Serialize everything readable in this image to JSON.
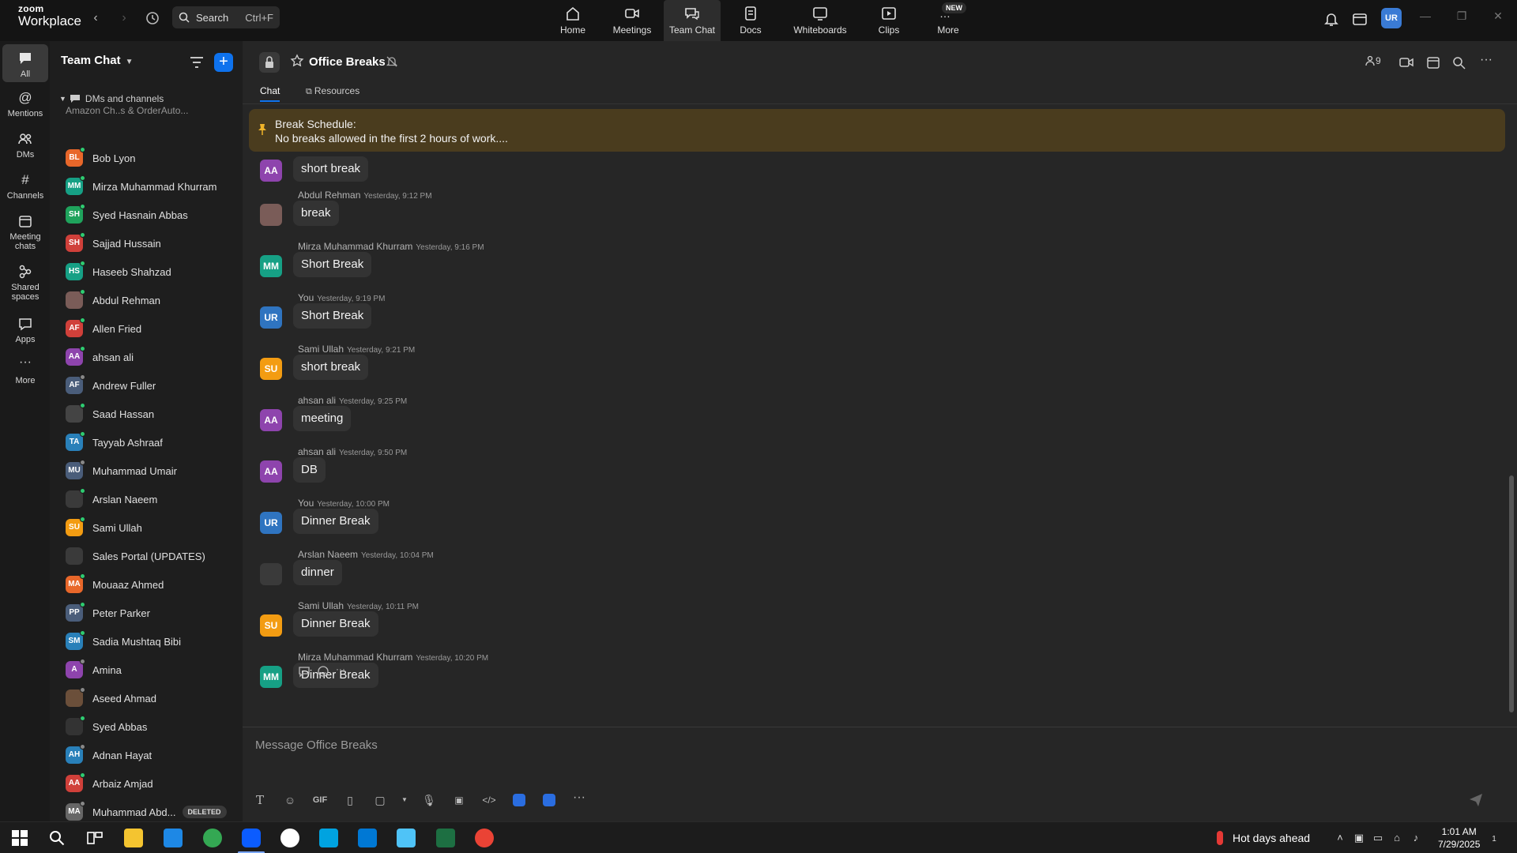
{
  "app": {
    "brand_small": "zoom",
    "brand_big": "Workplace"
  },
  "top_search": {
    "label": "Search",
    "shortcut": "Ctrl+F"
  },
  "top_tabs": [
    {
      "label": "Home"
    },
    {
      "label": "Meetings"
    },
    {
      "label": "Team Chat"
    },
    {
      "label": "Docs"
    },
    {
      "label": "Whiteboards"
    },
    {
      "label": "Clips"
    },
    {
      "label": "More"
    }
  ],
  "new_badge": "NEW",
  "user_initials": "UR",
  "rail": [
    {
      "label": "All"
    },
    {
      "label": "Mentions"
    },
    {
      "label": "DMs"
    },
    {
      "label": "Channels"
    },
    {
      "label": "Meeting chats"
    },
    {
      "label": "Shared spaces"
    },
    {
      "label": "Apps"
    },
    {
      "label": "More"
    }
  ],
  "channel_list": {
    "header": "Team Chat",
    "section": "DMs and channels",
    "partial_top": "Amazon Ch..s & OrderAuto...",
    "items": [
      {
        "initials": "BL",
        "name": "Bob Lyon",
        "color": "#e8672a",
        "status": "#2ecc71"
      },
      {
        "initials": "MM",
        "name": "Mirza Muhammad Khurram",
        "color": "#16a085",
        "status": "#2ecc71"
      },
      {
        "initials": "SH",
        "name": "Syed Hasnain Abbas",
        "color": "#1fa35c",
        "status": "#2ecc71"
      },
      {
        "initials": "SH",
        "name": "Sajjad Hussain",
        "color": "#d0403a",
        "status": "#2ecc71"
      },
      {
        "initials": "HS",
        "name": "Haseeb Shahzad",
        "color": "#16a085",
        "status": "#2ecc71"
      },
      {
        "initials": "",
        "name": "Abdul Rehman",
        "color": "#7a5c58",
        "status": "#2ecc71"
      },
      {
        "initials": "AF",
        "name": "Allen Fried",
        "color": "#d0403a",
        "status": "#2ecc71"
      },
      {
        "initials": "AA",
        "name": "ahsan ali",
        "color": "#8e44ad",
        "status": "#2ecc71"
      },
      {
        "initials": "AF",
        "name": "Andrew Fuller",
        "color": "#4a5d7a",
        "status": "#888888"
      },
      {
        "initials": "",
        "name": "Saad Hassan",
        "color": "#444444",
        "status": "#2ecc71"
      },
      {
        "initials": "TA",
        "name": "Tayyab Ashraaf",
        "color": "#2980b9",
        "status": "#2ecc71"
      },
      {
        "initials": "MU",
        "name": "Muhammad Umair",
        "color": "#4a5d7a",
        "status": "#888888"
      },
      {
        "initials": "",
        "name": "Arslan Naeem",
        "color": "#3a3a3a",
        "status": "#2ecc71"
      },
      {
        "initials": "SU",
        "name": "Sami Ullah",
        "color": "#f39c12",
        "status": "#2ecc71"
      },
      {
        "initials": "",
        "name": "Sales Portal (UPDATES)",
        "color": "#3a3a3a",
        "status": ""
      },
      {
        "initials": "MA",
        "name": "Mouaaz Ahmed",
        "color": "#e8672a",
        "status": "#2ecc71"
      },
      {
        "initials": "PP",
        "name": "Peter Parker",
        "color": "#4a5d7a",
        "status": "#2ecc71"
      },
      {
        "initials": "SM",
        "name": "Sadia Mushtaq Bibi",
        "color": "#2980b9",
        "status": "#2ecc71"
      },
      {
        "initials": "A",
        "name": "Amina",
        "color": "#8e44ad",
        "status": "#888888"
      },
      {
        "initials": "",
        "name": "Aseed Ahmad",
        "color": "#6b4f3a",
        "status": "#888888"
      },
      {
        "initials": "",
        "name": "Syed Abbas",
        "color": "#333333",
        "status": "#2ecc71"
      },
      {
        "initials": "AH",
        "name": "Adnan Hayat",
        "color": "#2980b9",
        "status": "#888888"
      },
      {
        "initials": "AA",
        "name": "Arbaiz Amjad",
        "color": "#d0403a",
        "status": "#2ecc71"
      },
      {
        "initials": "MA",
        "name": "Muhammad Abd...",
        "color": "#666666",
        "status": "#888888",
        "tag": "DELETED"
      }
    ]
  },
  "channel": {
    "title": "Office Breaks",
    "tabs": [
      "Chat",
      "Resources"
    ],
    "member_count": "9",
    "pinned_title": "Break Schedule:",
    "pinned_text": "No breaks allowed in the first 2 hours of work...."
  },
  "messages": [
    {
      "sender": "",
      "time": "",
      "text": "short break",
      "initials": "AA",
      "color": "#8e44ad"
    },
    {
      "sender": "Abdul Rehman",
      "time": "Yesterday, 9:12 PM",
      "text": "break",
      "initials": "",
      "color": "#7a5c58"
    },
    {
      "sender": "Mirza Muhammad Khurram",
      "time": "Yesterday, 9:16 PM",
      "text": "Short Break",
      "initials": "MM",
      "color": "#16a085"
    },
    {
      "sender": "You",
      "time": "Yesterday, 9:19 PM",
      "text": "Short Break",
      "initials": "UR",
      "color": "#2f74c0"
    },
    {
      "sender": "Sami Ullah",
      "time": "Yesterday, 9:21 PM",
      "text": "short break",
      "initials": "SU",
      "color": "#f39c12"
    },
    {
      "sender": "ahsan ali",
      "time": "Yesterday, 9:25 PM",
      "text": "meeting",
      "initials": "AA",
      "color": "#8e44ad"
    },
    {
      "sender": "ahsan ali",
      "time": "Yesterday, 9:50 PM",
      "text": "DB",
      "initials": "AA",
      "color": "#8e44ad"
    },
    {
      "sender": "You",
      "time": "Yesterday, 10:00 PM",
      "text": "Dinner Break",
      "initials": "UR",
      "color": "#2f74c0"
    },
    {
      "sender": "Arslan Naeem",
      "time": "Yesterday, 10:04 PM",
      "text": "dinner",
      "initials": "",
      "color": "#3a3a3a"
    },
    {
      "sender": "Sami Ullah",
      "time": "Yesterday, 10:11 PM",
      "text": "Dinner Break",
      "initials": "SU",
      "color": "#f39c12"
    },
    {
      "sender": "Mirza Muhammad Khurram",
      "time": "Yesterday, 10:20 PM",
      "text": "Dinner Break",
      "initials": "MM",
      "color": "#16a085"
    }
  ],
  "composer": {
    "placeholder": "Message Office Breaks",
    "gif_label": "GIF"
  },
  "taskbar": {
    "weather": "Hot days ahead",
    "time": "1:01 AM",
    "date": "7/29/2025",
    "notif_count": "1"
  }
}
